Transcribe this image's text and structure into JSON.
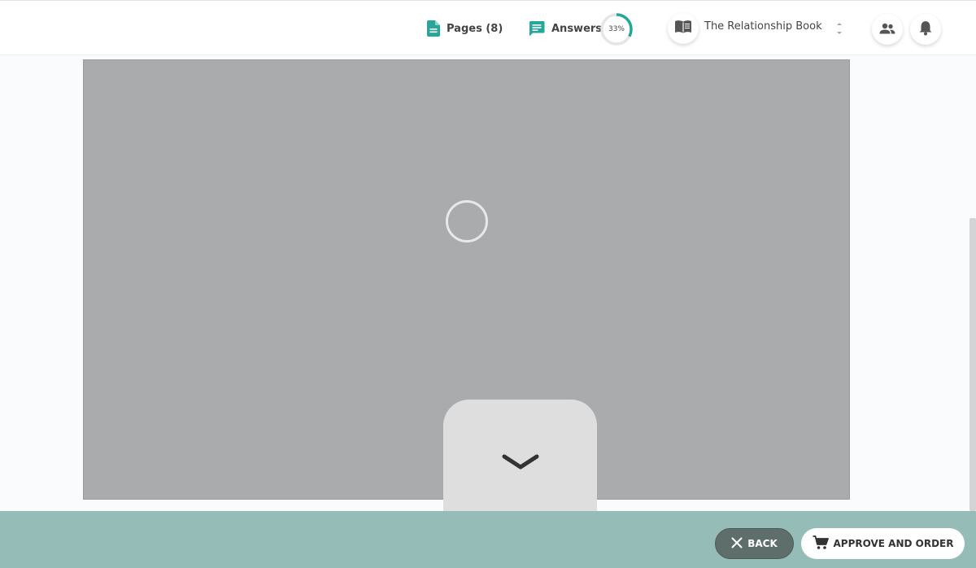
{
  "header": {
    "pages_label": "Pages (8)",
    "answers_label": "Answers",
    "answers_progress": {
      "percent": 33,
      "text": "33%"
    },
    "book_select": {
      "value": "The Relationship Book"
    }
  },
  "footer": {
    "back_label": "BACK",
    "approve_label": "APPROVE AND ORDER"
  },
  "colors": {
    "accent": "#27a69a",
    "footer_bg": "#96bcb8",
    "back_button_bg": "#5e6e6b",
    "preview_bg": "#aaabad"
  },
  "icons": {
    "pages": "document-icon",
    "answers": "chat-message-icon",
    "book": "open-book-icon",
    "collaborators": "people-icon",
    "notifications": "bell-icon",
    "expand": "chevron-down-icon",
    "back": "close-icon",
    "approve": "cart-icon",
    "loading": "loading-spinner-icon"
  }
}
